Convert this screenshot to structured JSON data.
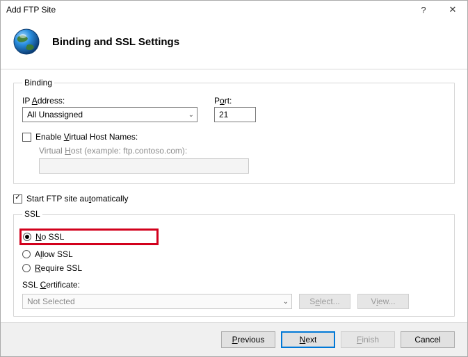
{
  "window": {
    "title": "Add FTP Site",
    "help": "?",
    "close": "✕"
  },
  "header": {
    "title": "Binding and SSL Settings"
  },
  "binding": {
    "legend": "Binding",
    "ip_label_pre": "IP ",
    "ip_label_accel": "A",
    "ip_label_post": "ddress:",
    "ip_value": "All Unassigned",
    "port_label_pre": "P",
    "port_label_accel": "o",
    "port_label_post": "rt:",
    "port_value": "21",
    "enable_vhost_pre": "Enable ",
    "enable_vhost_accel": "V",
    "enable_vhost_post": "irtual Host Names:",
    "vhost_label_pre": "Virtual ",
    "vhost_label_accel": "H",
    "vhost_label_post": "ost (example: ftp.contoso.com):",
    "vhost_value": "",
    "enable_vhost_checked": false
  },
  "autostart": {
    "label_pre": "Start FTP site au",
    "label_accel": "t",
    "label_post": "omatically",
    "checked": true
  },
  "ssl": {
    "legend": "SSL",
    "no_ssl_accel": "N",
    "no_ssl_post": "o SSL",
    "allow_pre": "A",
    "allow_accel": "l",
    "allow_post": "low SSL",
    "require_accel": "R",
    "require_post": "equire SSL",
    "selected": "no",
    "cert_label_pre": "SSL ",
    "cert_label_accel": "C",
    "cert_label_post": "ertificate:",
    "cert_value": "Not Selected",
    "select_btn_pre": "S",
    "select_btn_accel": "e",
    "select_btn_post": "lect...",
    "view_btn_pre": "V",
    "view_btn_accel": "i",
    "view_btn_post": "ew..."
  },
  "footer": {
    "previous_accel": "P",
    "previous_post": "revious",
    "next_accel": "N",
    "next_post": "ext",
    "finish_accel": "F",
    "finish_post": "inish",
    "cancel": "Cancel"
  }
}
